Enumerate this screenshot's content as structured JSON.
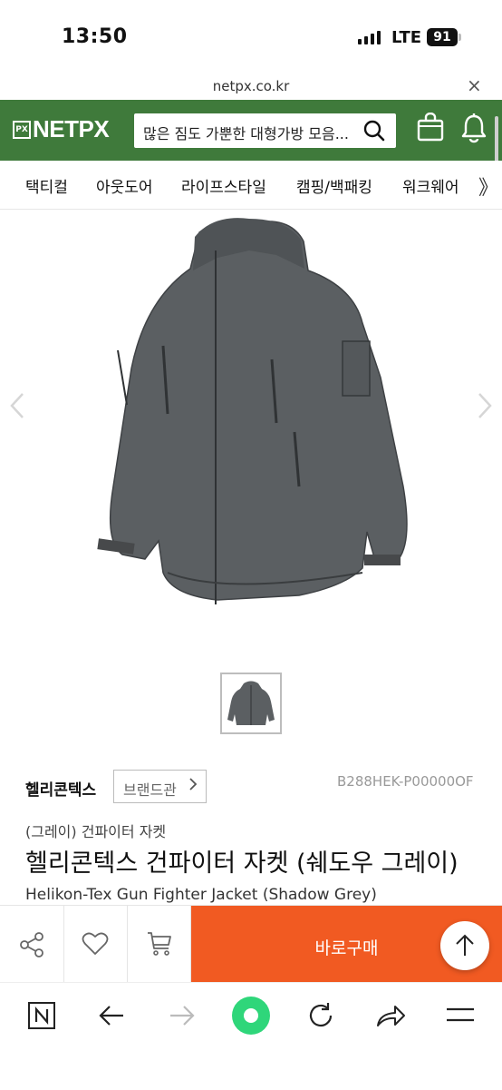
{
  "status_bar": {
    "time": "13:50",
    "network": "LTE",
    "battery": "91"
  },
  "browser": {
    "url": "netpx.co.kr",
    "close_symbol": "×"
  },
  "header": {
    "logo_box": "PX",
    "logo_text": "NETPX",
    "search_placeholder": "많은 짐도 가뿐한 대형가방 모음...",
    "brand_color": "#3f7a3b"
  },
  "nav": {
    "items": [
      "택티컬",
      "아웃도어",
      "라이프스타일",
      "캠핑/백패킹",
      "워크웨어"
    ],
    "more_symbol": "》"
  },
  "product": {
    "brand": "헬리콘텍스",
    "brand_button": "브랜드관",
    "sku": "B288HEK-P00000OF",
    "subtitle": "(그레이) 건파이터 자켓",
    "title": "헬리콘텍스 건파이터 자켓 (쉐도우 그레이)",
    "title_en": "Helikon-Tex Gun Fighter Jacket (Shadow Grey)"
  },
  "actions": {
    "buy_label": "바로구매",
    "accent_color": "#f15a22"
  },
  "icons": [
    "search-icon",
    "bag-icon",
    "bell-icon",
    "share-icon",
    "heart-icon",
    "cart-icon",
    "arrow-up-icon",
    "n-icon",
    "back-icon",
    "forward-icon",
    "home-circle-icon",
    "refresh-icon",
    "share-arrow-icon",
    "menu-icon"
  ]
}
